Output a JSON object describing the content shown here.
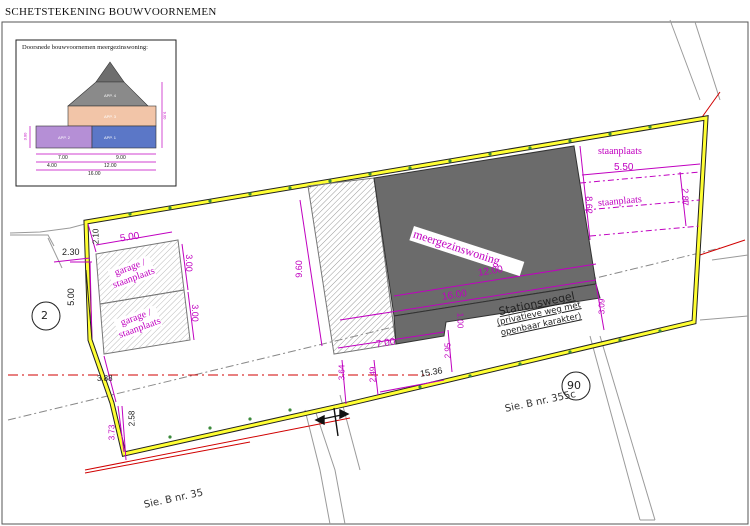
{
  "title": "SCHETSTEKENING BOUWVOORNEMEN",
  "inset": {
    "caption": "Doorsnede bouwvoornemen meergezinswoning:",
    "apartments": [
      "APP. 4",
      "APP. 3",
      "APP. 2",
      "APP. 1"
    ],
    "dims": [
      "7.00",
      "9.00",
      "4.00",
      "12.00",
      "16.00",
      "3.00",
      "9.00"
    ],
    "colors": {
      "roof": "#6e6e6e",
      "upper": "#8a8a8a",
      "middle": "#f2c5a8",
      "left": "#b58fd6",
      "right": "#5b77c7",
      "dim": "#c000c0"
    }
  },
  "labels": {
    "meergezinswoning": "meergezinswoning",
    "garage1": [
      "garage /",
      "staanplaats"
    ],
    "garage2": [
      "garage /",
      "staanplaats"
    ],
    "staanplaats_top": "staanplaats",
    "staanplaats_mid": "staanplaats",
    "street": [
      "Stationswegel",
      "(privatieve weg met",
      "openbaar karakter)"
    ],
    "num_90": "90",
    "num_2": "2",
    "sie1": "Sie. B nr. 355c",
    "sie2": "Sie. B nr. 35"
  },
  "dims": {
    "d_210": "2.10",
    "d_230": "2.30",
    "d_500a": "5.00",
    "d_500b": "5.00",
    "d_300a": "3.00",
    "d_300b": "3.00",
    "d_960": "9.60",
    "d_1200": "12.00",
    "d_1600": "16.00",
    "d_100": "1.00",
    "d_700": "7.00",
    "d_295": "2.95",
    "d_249": "2.49",
    "d_364": "3.64",
    "d_1536": "15.36",
    "d_309": "3.09",
    "d_550": "5.50",
    "d_862": "8.62",
    "d_287": "2.87",
    "d_388": "3.88",
    "d_258": "2.58",
    "d_373": "3.73"
  },
  "colors": {
    "boundary": "#ffff33",
    "dim": "#c000c0",
    "building": "#6b6b6b",
    "garage": "#e6e6e6",
    "redline": "#d00000"
  }
}
